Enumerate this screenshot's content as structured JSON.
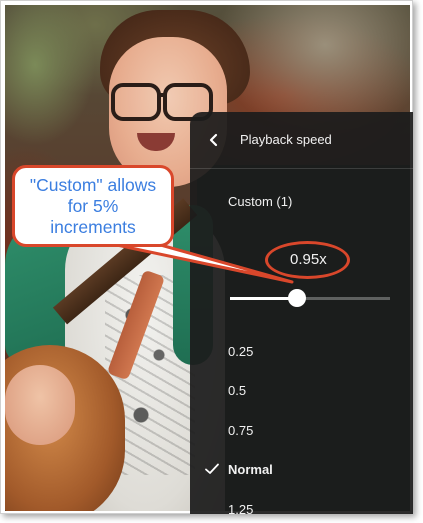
{
  "panel": {
    "title": "Playback speed",
    "custom_label": "Custom (1)",
    "current_speed": "0.95x",
    "slider_fraction": 0.42,
    "options": [
      {
        "label": "0.25",
        "selected": false
      },
      {
        "label": "0.5",
        "selected": false
      },
      {
        "label": "0.75",
        "selected": false
      },
      {
        "label": "Normal",
        "selected": true
      },
      {
        "label": "1.25",
        "selected": false
      }
    ]
  },
  "annotation": {
    "callout_lines": [
      "\"Custom\" allows",
      "for 5%",
      "increments"
    ],
    "accent_color": "#d9472b",
    "text_color": "#3b7ee0"
  },
  "icons": {
    "back": "chevron-left-icon",
    "check": "check-icon"
  }
}
